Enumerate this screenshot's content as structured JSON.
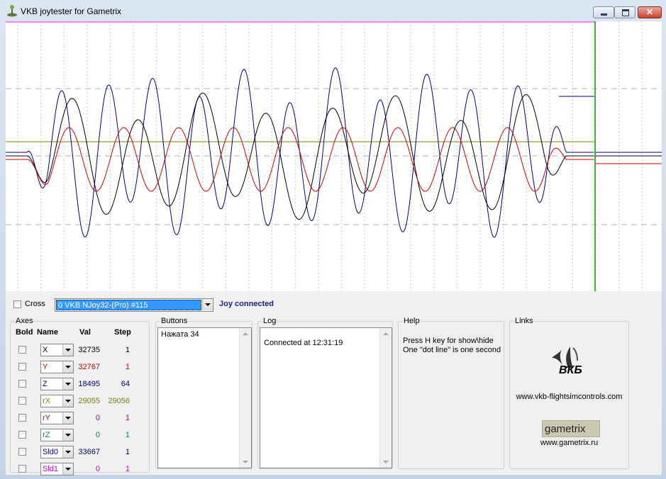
{
  "window": {
    "title": "VKB joytester for Gametrix"
  },
  "titlebar": {
    "close_glyph": "✕"
  },
  "controls": {
    "cross_label": "Cross",
    "device_value": "0 VKB NJoy32-(Pro)  #115",
    "status": "Joy connected",
    "status_color": "#1a237e"
  },
  "axes": {
    "title": "Axes",
    "headers": {
      "bold": "Bold",
      "name": "Name",
      "val": "Val",
      "step": "Step"
    },
    "rows": [
      {
        "name": "X",
        "val": "32735",
        "step": "1",
        "color": "#000000"
      },
      {
        "name": "Y",
        "val": "32767",
        "step": "1",
        "color": "#cc0000"
      },
      {
        "name": "Z",
        "val": "18495",
        "step": "64",
        "color": "#000080"
      },
      {
        "name": "rX",
        "val": "29055",
        "step": "29056",
        "color": "#808000"
      },
      {
        "name": "rY",
        "val": "0",
        "step": "1",
        "color": "#990099"
      },
      {
        "name": "rZ",
        "val": "0",
        "step": "1",
        "color": "#008080"
      },
      {
        "name": "Sld0",
        "val": "33667",
        "step": "1",
        "color": "#000080"
      },
      {
        "name": "Sld1",
        "val": "0",
        "step": "1",
        "color": "#cc00cc"
      }
    ]
  },
  "buttons": {
    "title": "Buttons",
    "items": [
      "Нажата 34"
    ]
  },
  "log": {
    "title": "Log",
    "items": [
      "Connected at 12:31:19"
    ]
  },
  "help": {
    "title": "Help",
    "lines": [
      "Press H key for show\\hide",
      "One \"dot line\" is one second"
    ]
  },
  "links": {
    "title": "Links",
    "vkb_logo_text": "ВКБ",
    "vkb_url": "www.vkb-flightsimcontrols.com",
    "gametrix_logo_text": "gametrix",
    "gametrix_url": "www.gametrix.ru"
  }
}
